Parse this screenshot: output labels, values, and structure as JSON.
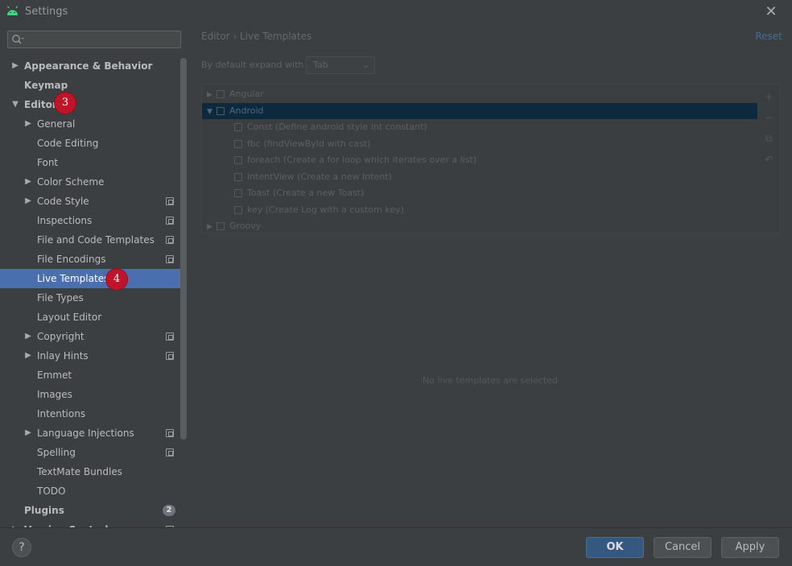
{
  "window": {
    "title": "Settings",
    "app_icon": "android-icon",
    "accent_color": "#4b6eaf",
    "badge_color": "#c0142b"
  },
  "search": {
    "placeholder": "",
    "value": ""
  },
  "tree": {
    "items": [
      {
        "label": "Appearance & Behavior",
        "level": 0,
        "bold": true,
        "arrow": "right"
      },
      {
        "label": "Keymap",
        "level": 0,
        "bold": true,
        "arrow": "none"
      },
      {
        "label": "Editor",
        "level": 0,
        "bold": true,
        "arrow": "down"
      },
      {
        "label": "General",
        "level": 1,
        "arrow": "right"
      },
      {
        "label": "Code Editing",
        "level": 1,
        "arrow": "none"
      },
      {
        "label": "Font",
        "level": 1,
        "arrow": "none"
      },
      {
        "label": "Color Scheme",
        "level": 1,
        "arrow": "right"
      },
      {
        "label": "Code Style",
        "level": 1,
        "arrow": "right",
        "project": true
      },
      {
        "label": "Inspections",
        "level": 1,
        "arrow": "none",
        "project": true
      },
      {
        "label": "File and Code Templates",
        "level": 1,
        "arrow": "none",
        "project": true
      },
      {
        "label": "File Encodings",
        "level": 1,
        "arrow": "none",
        "project": true
      },
      {
        "label": "Live Templates",
        "level": 1,
        "arrow": "none",
        "selected": true
      },
      {
        "label": "File Types",
        "level": 1,
        "arrow": "none"
      },
      {
        "label": "Layout Editor",
        "level": 1,
        "arrow": "none"
      },
      {
        "label": "Copyright",
        "level": 1,
        "arrow": "right",
        "project": true
      },
      {
        "label": "Inlay Hints",
        "level": 1,
        "arrow": "right",
        "project": true
      },
      {
        "label": "Emmet",
        "level": 1,
        "arrow": "none"
      },
      {
        "label": "Images",
        "level": 1,
        "arrow": "none"
      },
      {
        "label": "Intentions",
        "level": 1,
        "arrow": "none"
      },
      {
        "label": "Language Injections",
        "level": 1,
        "arrow": "right",
        "project": true
      },
      {
        "label": "Spelling",
        "level": 1,
        "arrow": "none",
        "project": true
      },
      {
        "label": "TextMate Bundles",
        "level": 1,
        "arrow": "none"
      },
      {
        "label": "TODO",
        "level": 1,
        "arrow": "none"
      },
      {
        "label": "Plugins",
        "level": 0,
        "bold": true,
        "arrow": "none",
        "count": "2"
      },
      {
        "label": "Version Control",
        "level": 0,
        "bold": true,
        "arrow": "right",
        "project": true
      }
    ]
  },
  "annotations": {
    "editor_step": "3",
    "live_templates_step": "4"
  },
  "main": {
    "breadcrumb": "Editor  ›  Live Templates",
    "reset_label": "Reset",
    "expand_label": "By default expand with",
    "expand_value": "Tab",
    "template_groups": [
      {
        "label": "Angular",
        "kind": "group",
        "arrow": "right"
      },
      {
        "label": "Android",
        "kind": "group",
        "arrow": "down",
        "selected": true
      },
      {
        "label": "Const (Define android style int constant)",
        "kind": "item"
      },
      {
        "label": "fbc (findViewById with cast)",
        "kind": "item"
      },
      {
        "label": "foreach (Create a for loop which iterates over a list)",
        "kind": "item"
      },
      {
        "label": "IntentView (Create a new Intent)",
        "kind": "item"
      },
      {
        "label": "Toast (Create a new Toast)",
        "kind": "item"
      },
      {
        "label": "key (Create Log with a custom key)",
        "kind": "item"
      },
      {
        "label": "Groovy",
        "kind": "group",
        "arrow": "right"
      }
    ],
    "side_tools": [
      "plus-icon",
      "minus-icon",
      "copy-icon",
      "undo-icon"
    ],
    "empty_message": "No live templates are selected"
  },
  "footer": {
    "help_label": "?",
    "ok_label": "OK",
    "cancel_label": "Cancel",
    "apply_label": "Apply"
  }
}
